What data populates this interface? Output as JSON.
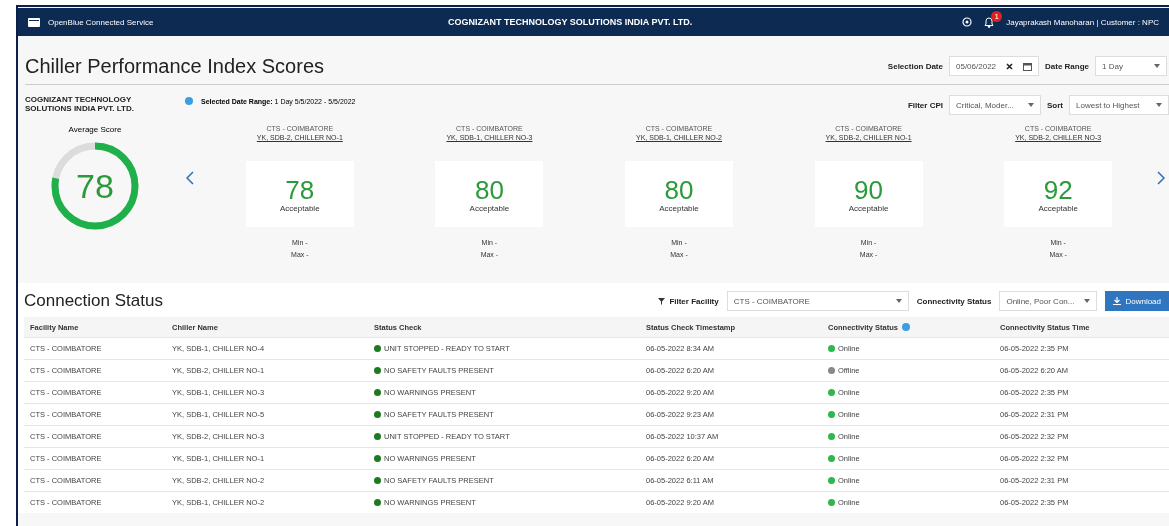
{
  "header": {
    "app_name": "OpenBlue Connected Service",
    "company": "COGNIZANT TECHNOLOGY SOLUTIONS INDIA PVT. LTD.",
    "notification_count": "1",
    "user": "Jayaprakash Manoharan | Customer : NPC"
  },
  "cpi": {
    "title": "Chiller Performance Index Scores",
    "selection_date_label": "Selection Date",
    "selection_date": "05/06/2022",
    "date_range_label": "Date Range",
    "date_range": "1 Day",
    "company": "COGNIZANT TECHNOLOGY SOLUTIONS INDIA PVT. LTD.",
    "selected_range_label": "Selected Date Range:",
    "selected_range": "1 Day   5/5/2022 - 5/5/2022",
    "filter_cpi_label": "Filter CPI",
    "filter_cpi": "Critical, Moder...",
    "sort_label": "Sort",
    "sort": "Lowest to Highest",
    "average_label": "Average Score",
    "average_score": "78",
    "level": 0.78,
    "cards": [
      {
        "facility": "CTS - COIMBATORE",
        "chiller": "YK, SDB-2, CHILLER NO-1",
        "score": "78",
        "rating": "Acceptable",
        "min": "Min -",
        "max": "Max -"
      },
      {
        "facility": "CTS - COIMBATORE",
        "chiller": "YK, SDB-1, CHILLER NO-3",
        "score": "80",
        "rating": "Acceptable",
        "min": "Min -",
        "max": "Max -"
      },
      {
        "facility": "CTS - COIMBATORE",
        "chiller": "YK, SDB-1, CHILLER NO-2",
        "score": "80",
        "rating": "Acceptable",
        "min": "Min -",
        "max": "Max -"
      },
      {
        "facility": "CTS - COIMBATORE",
        "chiller": "YK, SDB-2, CHILLER NO-1",
        "score": "90",
        "rating": "Acceptable",
        "min": "Min -",
        "max": "Max -"
      },
      {
        "facility": "CTS - COIMBATORE",
        "chiller": "YK, SDB-2, CHILLER NO-3",
        "score": "92",
        "rating": "Acceptable",
        "min": "Min -",
        "max": "Max -"
      }
    ]
  },
  "connection": {
    "title": "Connection Status",
    "filter_facility_label": "Filter Facility",
    "filter_facility": "CTS - COIMBATORE",
    "connectivity_label": "Connectivity Status",
    "connectivity": "Online, Poor Con...",
    "download": "Download",
    "columns": [
      "Facility Name",
      "Chiller Name",
      "Status Check",
      "Status Check Timestamp",
      "Connectivity Status",
      "Connectivity Status Time"
    ],
    "rows": [
      {
        "facility": "CTS - COIMBATORE",
        "chiller": "YK, SDB-1, CHILLER NO-4",
        "status": "UNIT STOPPED - READY TO START",
        "timestamp": "06-05-2022 8:34 AM",
        "connectivity": "Online",
        "color": "#2db84d",
        "time": "06-05-2022 2:35 PM"
      },
      {
        "facility": "CTS - COIMBATORE",
        "chiller": "YK, SDB-2, CHILLER NO-1",
        "status": "NO SAFETY FAULTS PRESENT",
        "timestamp": "06-05-2022 6:20 AM",
        "connectivity": "Offline",
        "color": "#888888",
        "time": "06-05-2022 6:20 AM"
      },
      {
        "facility": "CTS - COIMBATORE",
        "chiller": "YK, SDB-1, CHILLER NO-3",
        "status": "NO WARNINGS PRESENT",
        "timestamp": "06-05-2022 9:20 AM",
        "connectivity": "Online",
        "color": "#2db84d",
        "time": "06-05-2022 2:35 PM"
      },
      {
        "facility": "CTS - COIMBATORE",
        "chiller": "YK, SDB-1, CHILLER NO-5",
        "status": "NO SAFETY FAULTS PRESENT",
        "timestamp": "06-05-2022 9:23 AM",
        "connectivity": "Online",
        "color": "#2db84d",
        "time": "06-05-2022 2:31 PM"
      },
      {
        "facility": "CTS - COIMBATORE",
        "chiller": "YK, SDB-2, CHILLER NO-3",
        "status": "UNIT STOPPED - READY TO START",
        "timestamp": "06-05-2022 10:37 AM",
        "connectivity": "Online",
        "color": "#2db84d",
        "time": "06-05-2022 2:32 PM"
      },
      {
        "facility": "CTS - COIMBATORE",
        "chiller": "YK, SDB-1, CHILLER NO-1",
        "status": "NO WARNINGS PRESENT",
        "timestamp": "06-05-2022 6:20 AM",
        "connectivity": "Online",
        "color": "#2db84d",
        "time": "06-05-2022 2:32 PM"
      },
      {
        "facility": "CTS - COIMBATORE",
        "chiller": "YK, SDB-2, CHILLER NO-2",
        "status": "NO SAFETY FAULTS PRESENT",
        "timestamp": "06-05-2022 6:11 AM",
        "connectivity": "Online",
        "color": "#2db84d",
        "time": "06-05-2022 2:31 PM"
      },
      {
        "facility": "CTS - COIMBATORE",
        "chiller": "YK, SDB-1, CHILLER NO-2",
        "status": "NO WARNINGS PRESENT",
        "timestamp": "06-05-2022 9:20 AM",
        "connectivity": "Online",
        "color": "#2db84d",
        "time": "06-05-2022 2:35 PM"
      }
    ]
  }
}
